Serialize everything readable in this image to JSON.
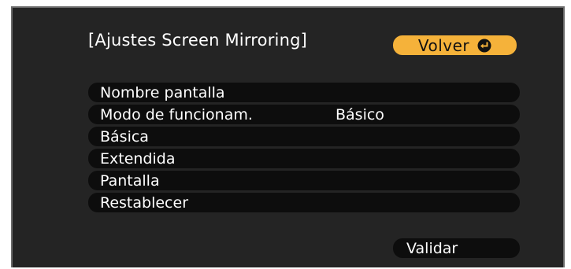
{
  "dialog": {
    "title": "[Ajustes Screen Mirroring]",
    "back_label": "Volver"
  },
  "menu": {
    "items": [
      {
        "label": "Nombre pantalla",
        "value": ""
      },
      {
        "label": "Modo de funcionam.",
        "value": "Básico"
      },
      {
        "label": "Básica",
        "value": ""
      },
      {
        "label": "Extendida",
        "value": ""
      },
      {
        "label": "Pantalla",
        "value": ""
      },
      {
        "label": "Restablecer",
        "value": ""
      }
    ]
  },
  "footer": {
    "validate_label": "Validar"
  },
  "colors": {
    "background": "#242424",
    "item_background": "#0d0d0d",
    "accent": "#f5b23a",
    "text": "#ffffff"
  },
  "icons": {
    "back": "enter-return-icon"
  }
}
